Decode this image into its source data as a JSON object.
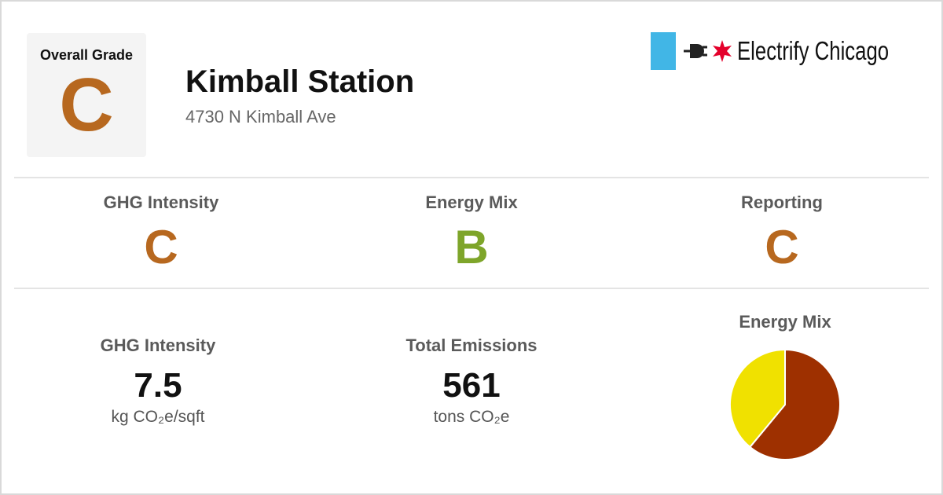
{
  "overall": {
    "label": "Overall Grade",
    "grade": "C"
  },
  "building": {
    "name": "Kimball Station",
    "address": "4730 N Kimball Ave"
  },
  "brand": {
    "name": "Electrify Chicago",
    "flag_color": "#41b6e6",
    "star_color": "#e4002b",
    "icon": "plug-icon"
  },
  "grades": [
    {
      "label": "GHG Intensity",
      "grade": "C",
      "color": "#b7681f"
    },
    {
      "label": "Energy Mix",
      "grade": "B",
      "color": "#7ea52a"
    },
    {
      "label": "Reporting",
      "grade": "C",
      "color": "#b7681f"
    }
  ],
  "metrics": [
    {
      "label": "GHG Intensity",
      "value": "7.5",
      "unit": "kg CO₂e/sqft"
    },
    {
      "label": "Total Emissions",
      "value": "561",
      "unit": "tons CO₂e"
    }
  ],
  "energy_mix": {
    "title": "Energy Mix",
    "chart_data": {
      "type": "pie",
      "title": "Energy Mix",
      "slices": [
        {
          "value": 0.61,
          "color": "#9e3000"
        },
        {
          "value": 0.39,
          "color": "#f0e100"
        }
      ]
    }
  },
  "colors": {
    "grade_c": "#b7681f",
    "grade_b": "#7ea52a"
  }
}
